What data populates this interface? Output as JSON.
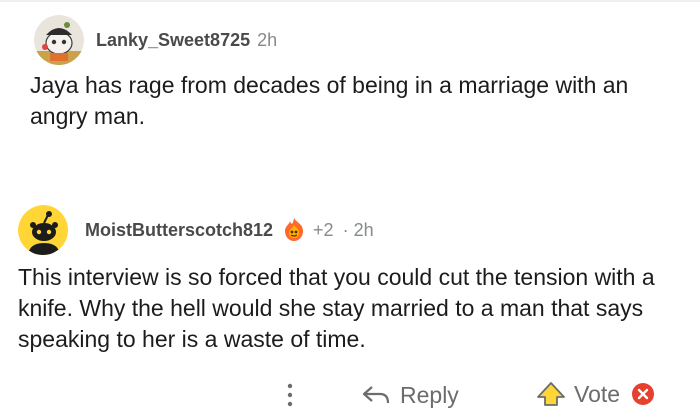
{
  "comments": [
    {
      "username": "Lanky_Sweet8725",
      "time": "2h",
      "text": "Jaya has rage from decades of being in a marriage with an angry man."
    },
    {
      "username": "MoistButterscotch812",
      "score": "+2",
      "separator": "·",
      "time": "2h",
      "text": "This interview is so forced that you could cut the tension with a knife. Why the hell would she stay married to a man that says speaking to her is a waste of time."
    }
  ],
  "actions": {
    "reply_label": "Reply",
    "vote_label": "Vote"
  },
  "icons": {
    "avatar1": "snoo-avatar-icon",
    "avatar2": "default-snoo-avatar-icon",
    "award": "flaming-award-icon",
    "more": "more-options-icon",
    "reply": "reply-arrow-icon",
    "vote": "upvote-icon",
    "close": "close-icon"
  },
  "colors": {
    "username": "#4a4a4a",
    "meta": "#878a8c",
    "body": "#1c1c1c",
    "avatar2_bg": "#ffd635",
    "close_badge": "#e6402e"
  }
}
